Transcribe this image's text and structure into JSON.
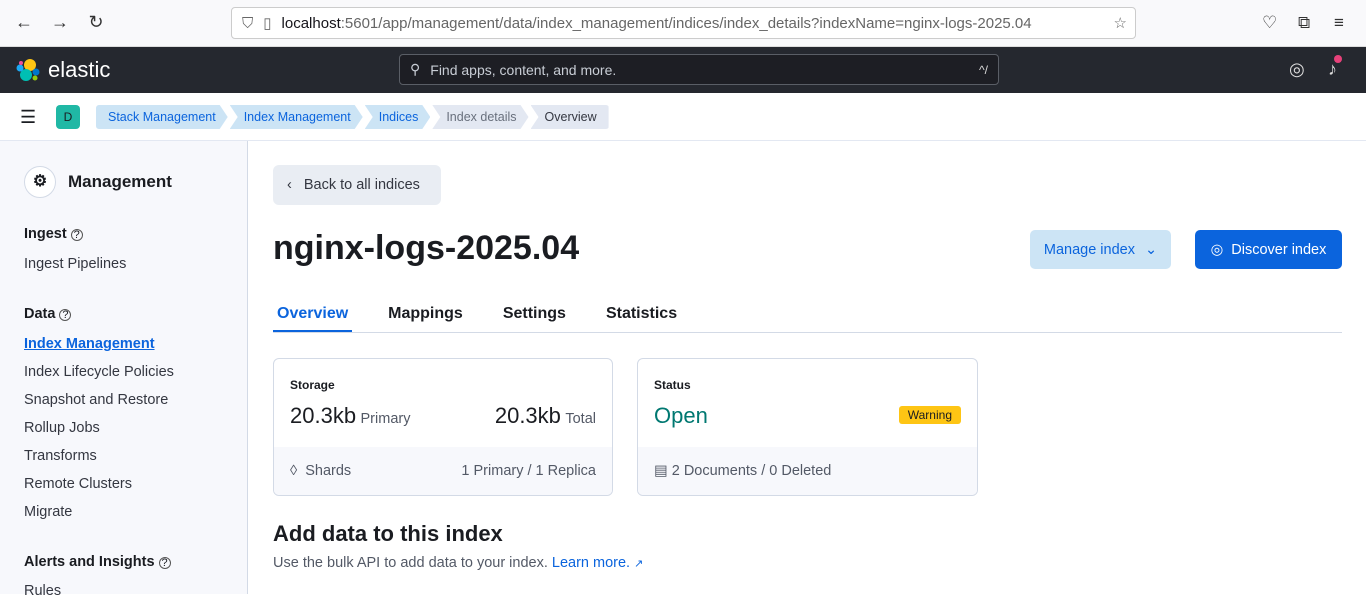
{
  "browser": {
    "url_host": "localhost",
    "url_path": ":5601/app/management/data/index_management/indices/index_details?indexName=nginx-logs-2025.04"
  },
  "header": {
    "brand": "elastic",
    "search_placeholder": "Find apps, content, and more.",
    "search_shortcut": "^/"
  },
  "breadcrumbs": {
    "avatar": "D",
    "items": [
      "Stack Management",
      "Index Management",
      "Indices",
      "Index details",
      "Overview"
    ]
  },
  "sidebar": {
    "title": "Management",
    "sections": [
      {
        "label": "Ingest",
        "items": [
          "Ingest Pipelines"
        ]
      },
      {
        "label": "Data",
        "items": [
          "Index Management",
          "Index Lifecycle Policies",
          "Snapshot and Restore",
          "Rollup Jobs",
          "Transforms",
          "Remote Clusters",
          "Migrate"
        ]
      },
      {
        "label": "Alerts and Insights",
        "items": [
          "Rules"
        ]
      }
    ],
    "active": "Index Management"
  },
  "main": {
    "back": "Back to all indices",
    "title": "nginx-logs-2025.04",
    "manage": "Manage index",
    "discover": "Discover index",
    "tabs": [
      "Overview",
      "Mappings",
      "Settings",
      "Statistics"
    ],
    "storage": {
      "label": "Storage",
      "primary_value": "20.3kb",
      "primary_label": "Primary",
      "total_value": "20.3kb",
      "total_label": "Total",
      "shards_label": "Shards",
      "shards_value": "1 Primary / 1 Replica"
    },
    "status": {
      "label": "Status",
      "value": "Open",
      "badge": "Warning",
      "docs": "2 Documents / 0 Deleted",
      "status_color": "#007871",
      "badge_color": "#fec514"
    },
    "add_title": "Add data to this index",
    "add_text": "Use the bulk API to add data to your index.",
    "learn_more": "Learn more."
  }
}
